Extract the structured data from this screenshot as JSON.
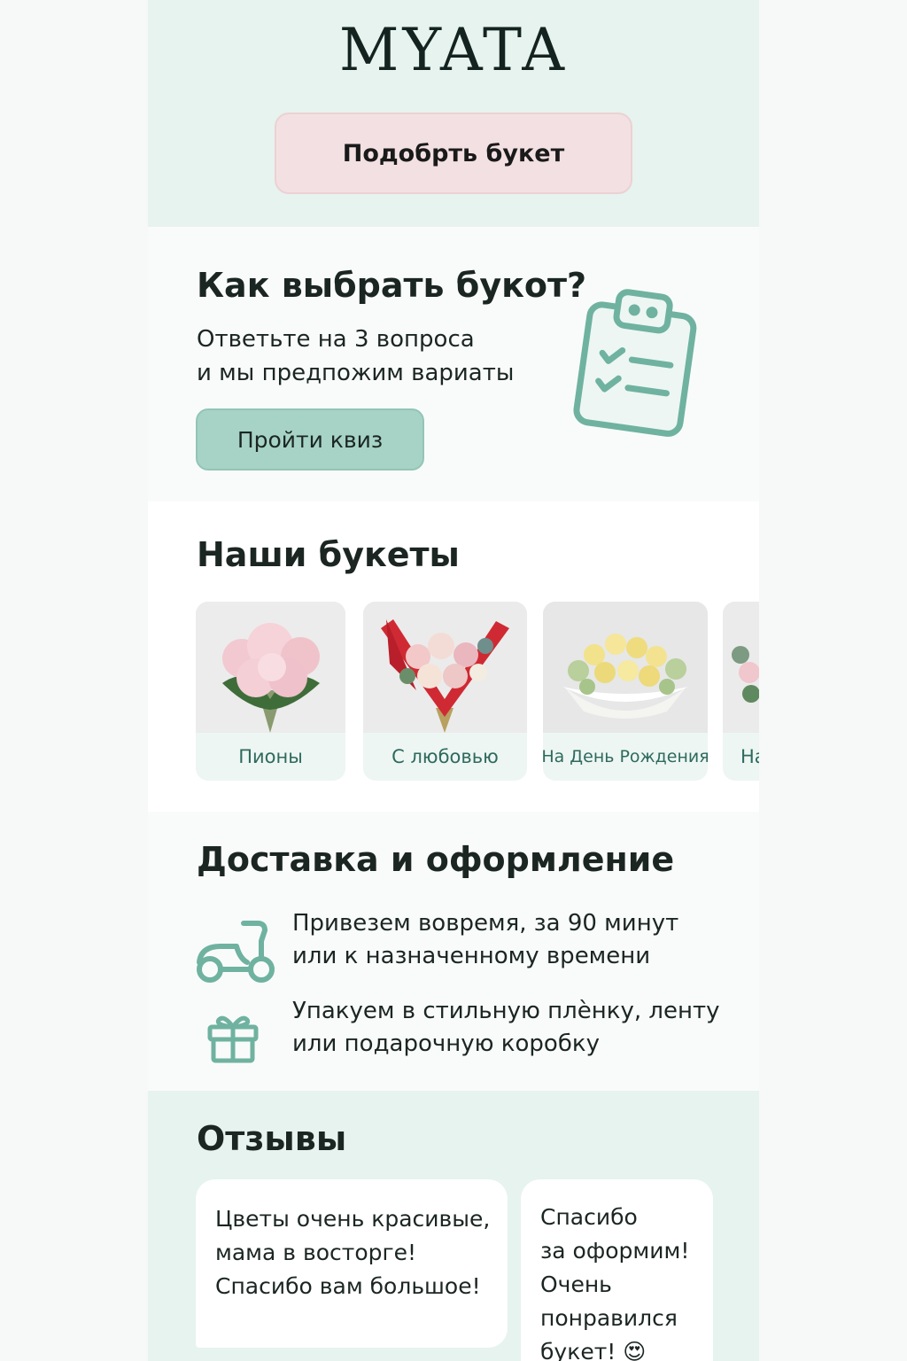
{
  "brand": {
    "logo": "MYATA"
  },
  "hero": {
    "button_label": "Подобрть букет"
  },
  "quiz": {
    "title": "Как выбрать букот?",
    "subtitle_line1": "Ответьте на 3 вопроса",
    "subtitle_line2": "и мы предпожим вариаты",
    "button_label": "Пройти квиз",
    "icon": "clipboard-checklist-icon"
  },
  "bouquets": {
    "title": "Наши букеты",
    "items": [
      {
        "label": "Пионы"
      },
      {
        "label": "С любовью"
      },
      {
        "label": "На День Рождения"
      },
      {
        "label": "На"
      }
    ]
  },
  "delivery": {
    "title": "Доставка и оформление",
    "items": [
      {
        "icon": "scooter-icon",
        "line1": "Привезем вовремя, за 90 минут",
        "line2": "или к назначенному времени"
      },
      {
        "icon": "gift-icon",
        "line1": "Упакуем в стильную плѐнку, ленту",
        "line2": "или подарочную коробку"
      }
    ]
  },
  "reviews": {
    "title": "Отзывы",
    "items": [
      {
        "lines": [
          "Цветы очень красивые,",
          "мама в восторге!",
          "Спасибо вам большое!"
        ]
      },
      {
        "lines": [
          "Спасибо",
          "за оформим!",
          "Очень",
          "понравился",
          "букет! 😍"
        ]
      }
    ]
  },
  "colors": {
    "accent": "#6fb2a0",
    "hero_bg": "#e6f3ef",
    "pink_button": "#f3e0e2",
    "mint_button": "#a6d3c5"
  }
}
